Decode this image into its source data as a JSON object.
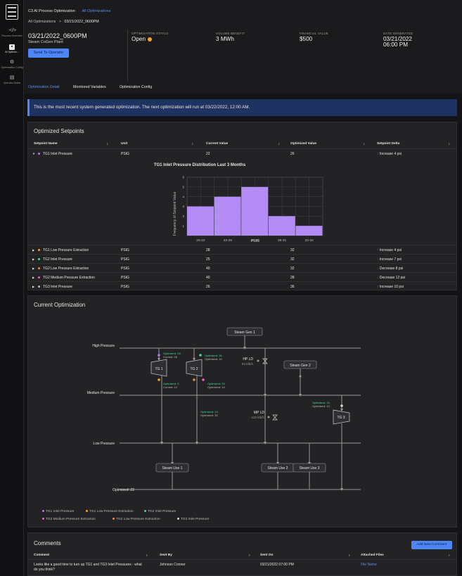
{
  "rail": {
    "logo_label": "C3.ai",
    "items": [
      {
        "icon": "code-icon",
        "label": "Process Overview"
      },
      {
        "icon": "ai-optimization-icon",
        "label": "AI Optimiz..."
      },
      {
        "icon": "gear-icon",
        "label": "Optimization Config"
      },
      {
        "icon": "operator-notes-icon",
        "label": "Operator Notes"
      }
    ]
  },
  "header": {
    "app_title": "C3 AI Process Optimization",
    "app_link": "All Optimizations",
    "breadcrumb_root": "All Optimizations",
    "breadcrumb_sep": ">",
    "breadcrumb_current": "03/21/2022_0600PM",
    "title": "03/21/2022_0600PM",
    "subtitle": "Steam CoGen Plant",
    "send_button": "Send To Operator",
    "kpis": [
      {
        "label": "OPTIMIZATION STATUS",
        "value": "Open"
      },
      {
        "label": "VOLUME BENEFIT",
        "value": "3 MWh"
      },
      {
        "label": "FINANCIAL VALUE",
        "value": "$500"
      },
      {
        "label": "DATE GENERATED",
        "value": "03/21/2022 06:00 PM"
      }
    ],
    "tabs": [
      "Optimization Detail",
      "Monitored Variables",
      "Optimization Config"
    ],
    "status_color": "#f5a623",
    "accent": "#4f86f7"
  },
  "banner": "This is the most recent system generated optimization. The next optimization will run at 03/22/2022, 12:00 AM.",
  "setpoints": {
    "title": "Optimized Setpoints",
    "columns": [
      "Setpoint Name",
      "Unit",
      "Current Value",
      "Optimized Value",
      "Setpoint Delta"
    ],
    "rows": [
      {
        "name": "TG1 Inlet Pressure",
        "unit": "PSIG",
        "current": "22",
        "optimized": "26",
        "delta": "Increase 4 psi",
        "dir": "up",
        "color": "#b07cf0"
      },
      {
        "name": "TG1 Low Pressure Extraction",
        "unit": "PSIG",
        "current": "28",
        "optimized": "32",
        "delta": "Increase 4 psi",
        "dir": "up",
        "color": "#f5a623"
      },
      {
        "name": "TG2 Inlet Pressure",
        "unit": "PSIG",
        "current": "25",
        "optimized": "32",
        "delta": "Increase 7 psi",
        "dir": "up",
        "color": "#3ddc97"
      },
      {
        "name": "TG2 Low Pressure Extraction",
        "unit": "PSIG",
        "current": "40",
        "optimized": "32",
        "delta": "Decrease 8 psi",
        "dir": "down",
        "color": "#f08a3c"
      },
      {
        "name": "TG2 Medium Pressure Extraction",
        "unit": "PSIG",
        "current": "40",
        "optimized": "28",
        "delta": "Decrease 12 psi",
        "dir": "down",
        "color": "#e066c6"
      },
      {
        "name": "TG3 Inlet Pressure",
        "unit": "PSIG",
        "current": "26",
        "optimized": "36",
        "delta": "Increase 10 psi",
        "dir": "up",
        "color": "#bdbdbd"
      }
    ]
  },
  "chart_data": {
    "type": "bar",
    "title": "TG1 Inlet Pressure Distribution Last 3 Months",
    "xlabel": "PSIG",
    "ylabel": "Frequency of Setpoint Value",
    "categories": [
      "20-22",
      "23-25",
      "26-28",
      "29-31",
      "32-34"
    ],
    "values": [
      3,
      4,
      5,
      2,
      1
    ],
    "ylim": [
      0,
      6
    ],
    "yticks": [
      "1",
      "2",
      "3",
      "4",
      "5",
      "6"
    ],
    "color": "#b48cf5",
    "grid": true
  },
  "current_opt": {
    "title": "Current Optimization",
    "headers": [
      "High Pressure",
      "Medium Pressure",
      "Low Pressure"
    ],
    "steam_gens": [
      "Steam Gen 1",
      "Steam Gen 2"
    ],
    "turbines": [
      "TG 1",
      "TG 2",
      "TG 3"
    ],
    "steam_uses": [
      "Steam Use 1",
      "Steam Use 2",
      "Steam Use 3"
    ],
    "valves": [
      {
        "name": "HP LD",
        "value": "92 klb/h"
      },
      {
        "name": "MP LD",
        "value": "120 klb/h"
      }
    ],
    "annotations": [
      {
        "opt": "Optimized: 26",
        "cur": "Current: 28"
      },
      {
        "opt": "Optimized: 36",
        "cur": "Optimized: 10"
      },
      {
        "opt": "Optimized: 9",
        "cur": "Current: 12"
      },
      {
        "opt": "Optimized: 25",
        "cur": "Optimized: 14"
      },
      {
        "opt": "Optimized: 14",
        "cur": "Optimized: 32"
      },
      {
        "opt": "Optimized: 15",
        "cur": "Optimized: 13"
      }
    ],
    "bottom_label": "Optimized: 22",
    "legend": [
      {
        "label": "TG1 Inlet Pressure",
        "color": "#b07cf0"
      },
      {
        "label": "TG1 Low Pressure Extraction",
        "color": "#f5a623"
      },
      {
        "label": "TG2 Inlet Pressure",
        "color": "#3ddc97"
      },
      {
        "label": "TG2 Medium Pressure Extraction",
        "color": "#e066c6"
      },
      {
        "label": "TG2 Low Pressure Extraction",
        "color": "#f08a3c"
      },
      {
        "label": "TG3 Inlet Pressure",
        "color": "#d9d9d9"
      }
    ]
  },
  "comments": {
    "title": "Comments",
    "add_button": "Add New Comment",
    "columns": [
      "Comment",
      "Sent By",
      "Sent On",
      "Attached Files"
    ],
    "rows": [
      {
        "comment": "Looks like a good time to turn up TG1 and TG3 Inlet Pressures - what do you think?",
        "sent_by": "Johnson Conner",
        "sent_on": "03/21/2022 07:00 PM",
        "file": "File Name"
      }
    ]
  }
}
